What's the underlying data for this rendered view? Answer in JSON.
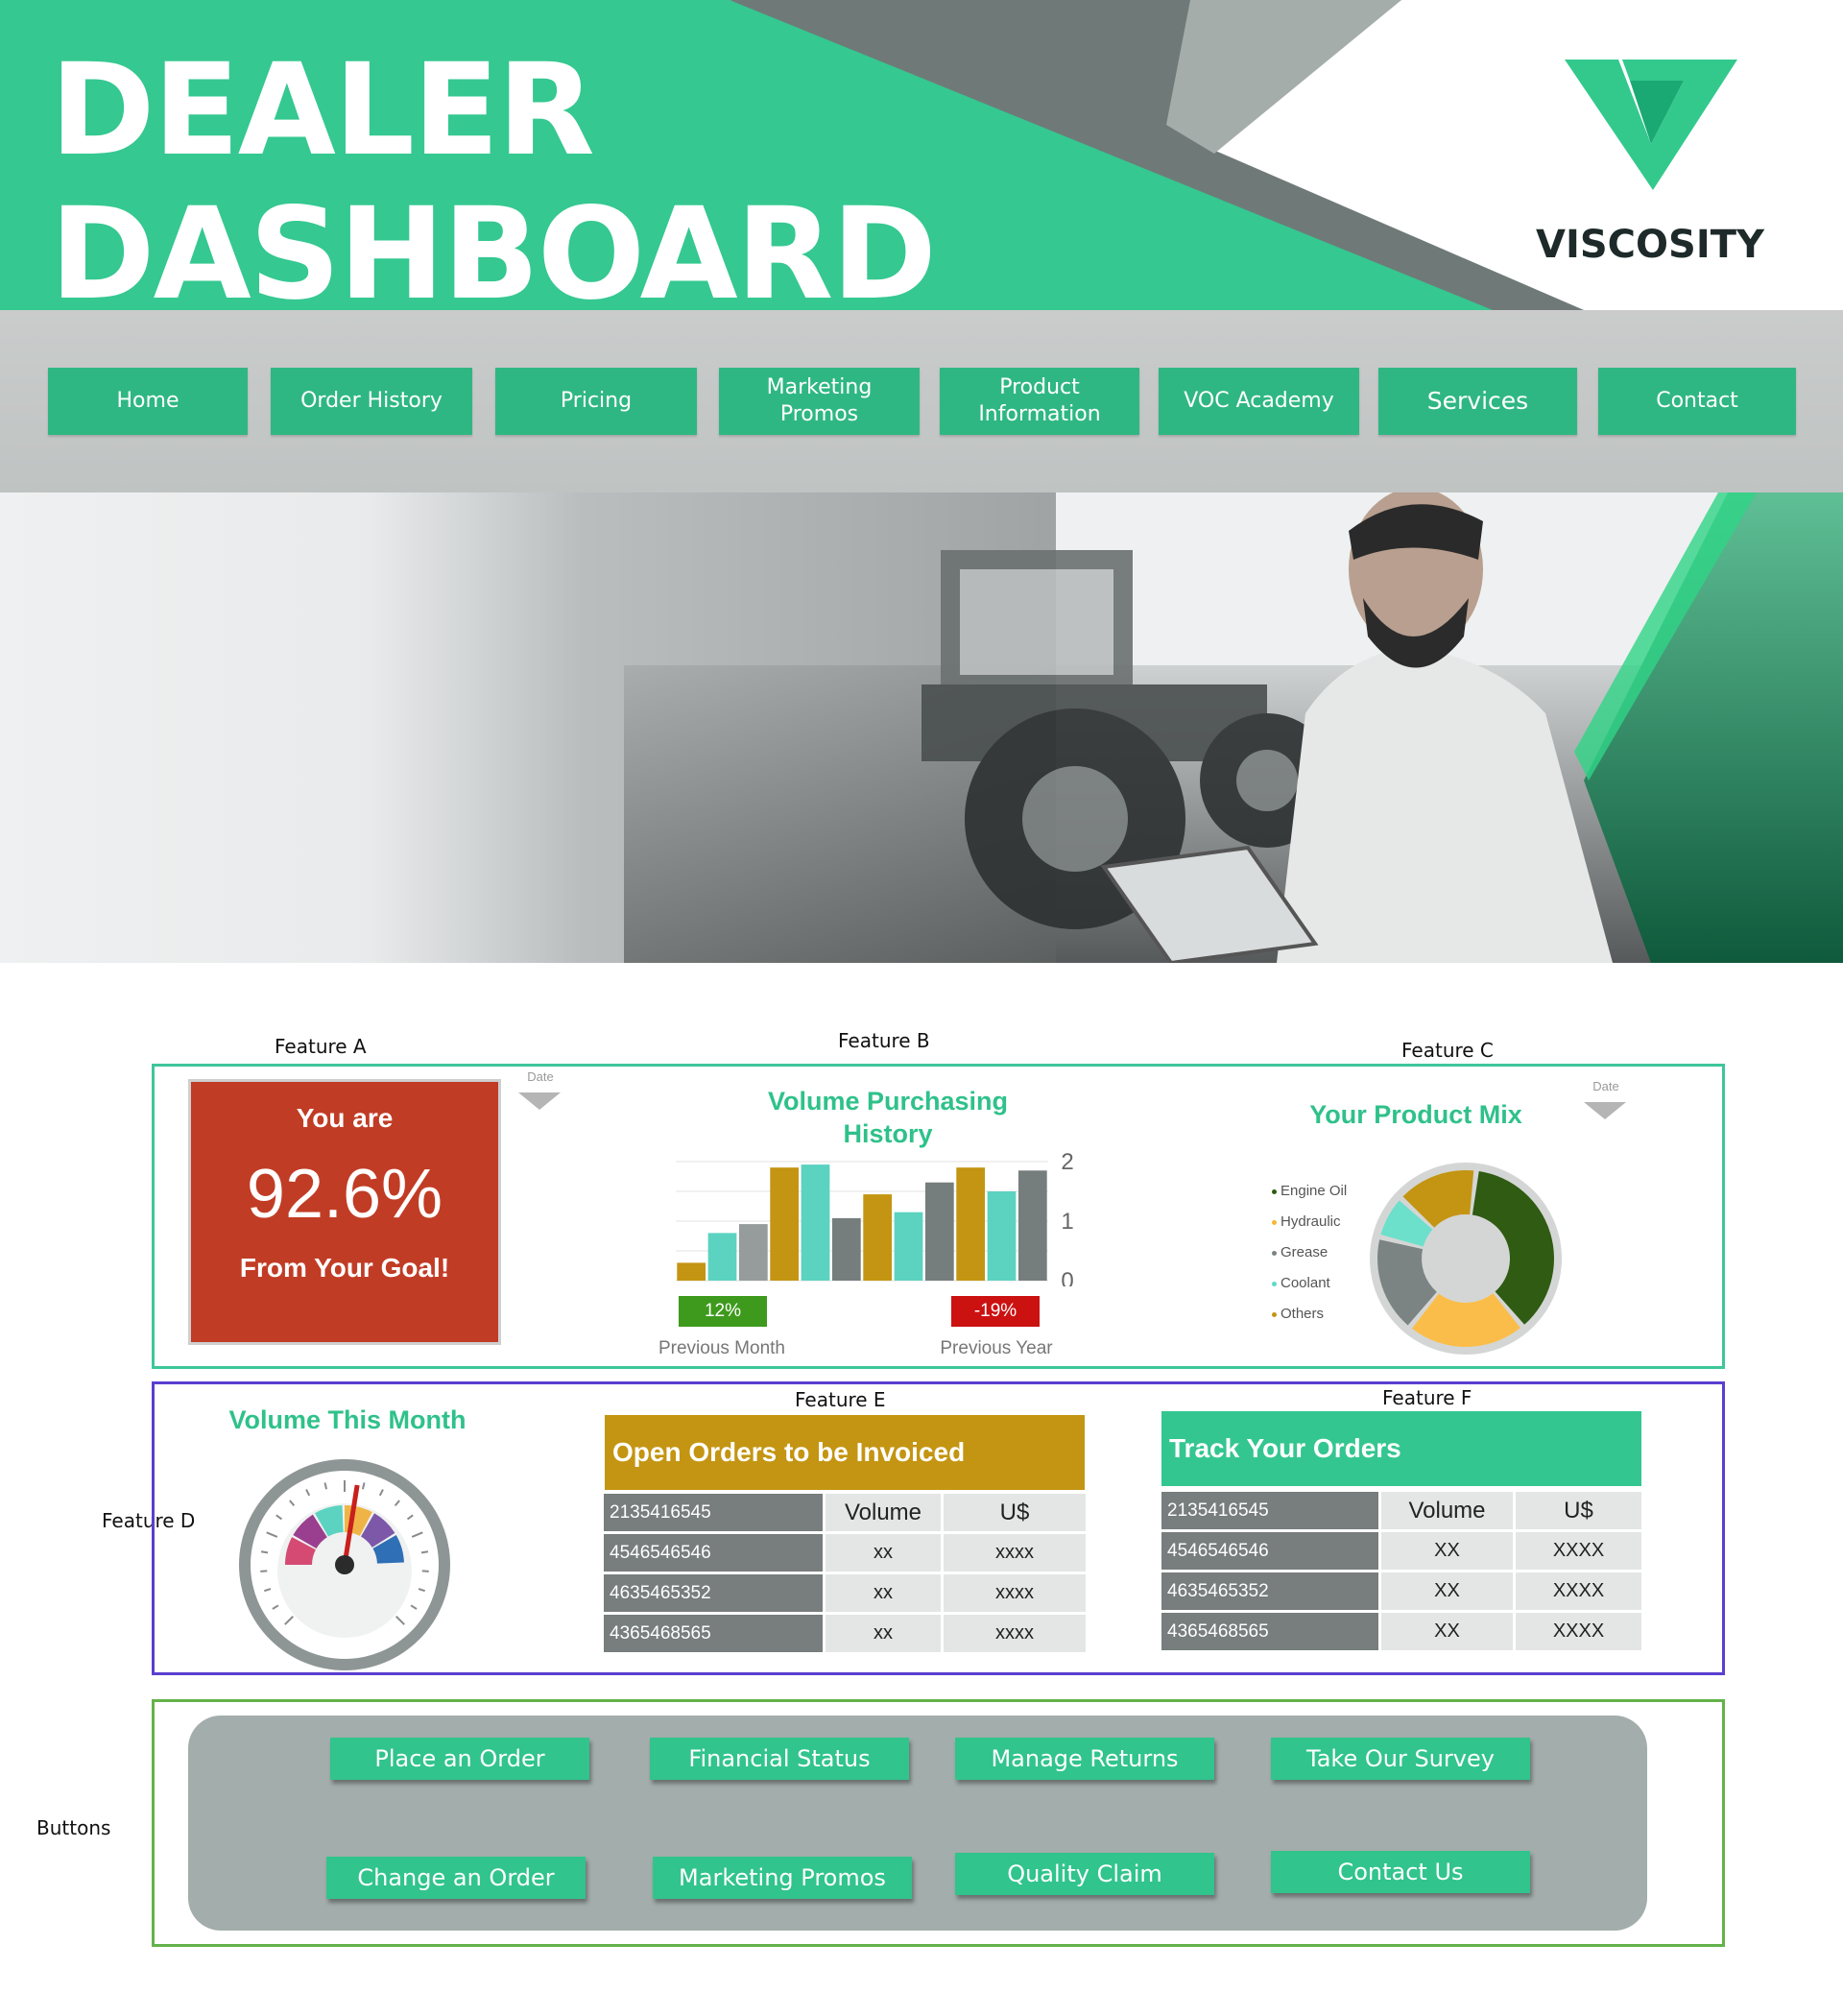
{
  "header": {
    "title_line1": "DEALER",
    "title_line2": "DASHBOARD",
    "logo_text": "VISCOSITY"
  },
  "nav": {
    "items": [
      {
        "label": "Home"
      },
      {
        "label": "Order History"
      },
      {
        "label": "Pricing"
      },
      {
        "label": "Marketing\nPromos"
      },
      {
        "label": "Product\nInformation"
      },
      {
        "label": "VOC Academy"
      },
      {
        "label": "Services"
      },
      {
        "label": "Contact"
      }
    ]
  },
  "features": {
    "a_label": "Feature A",
    "b_label": "Feature B",
    "c_label": "Feature C",
    "d_label": "Feature D",
    "e_label": "Feature E",
    "f_label": "Feature F",
    "buttons_label": "Buttons"
  },
  "feature_a": {
    "line1": "You are",
    "percent": "92.6%",
    "line2": "From Your Goal!",
    "date_label": "Date",
    "card_color": "#c13c25"
  },
  "feature_b": {
    "title_line1": "Volume Purchasing",
    "title_line2": "History",
    "previous_month_change": "12%",
    "previous_month_label": "Previous Month",
    "previous_year_change": "-19%",
    "previous_year_label": "Previous Year",
    "positive_color": "#3d9a1c",
    "negative_color": "#cc1111"
  },
  "feature_c": {
    "title": "Your Product Mix",
    "date_label": "Date"
  },
  "feature_d": {
    "title": "Volume This Month"
  },
  "feature_e": {
    "title": "Open Orders to be Invoiced",
    "header_color": "#c49512",
    "columns": [
      "2135416545",
      "Volume",
      "U$"
    ],
    "rows": [
      [
        "4546546546",
        "xx",
        "xxxx"
      ],
      [
        "4635465352",
        "xx",
        "xxxx"
      ],
      [
        "4365468565",
        "xx",
        "xxxx"
      ]
    ]
  },
  "feature_f": {
    "title": "Track Your Orders",
    "header_color": "#34c690",
    "columns": [
      "2135416545",
      "Volume",
      "U$"
    ],
    "rows": [
      [
        "4546546546",
        "XX",
        "XXXX"
      ],
      [
        "4635465352",
        "XX",
        "XXXX"
      ],
      [
        "4365468565",
        "XX",
        "XXXX"
      ]
    ]
  },
  "buttons": {
    "row1": [
      "Place an Order",
      "Financial Status",
      "Manage Returns",
      "Take Our Survey"
    ],
    "row2": [
      "Change an Order",
      "Marketing Promos",
      "Quality Claim",
      "Contact Us"
    ]
  },
  "chart_data": [
    {
      "type": "bar",
      "ylim": [
        0,
        2
      ],
      "yticks": [
        "2",
        "1",
        "0"
      ],
      "series_colors": [
        "#c49512",
        "#5bd3c0",
        "#959c9b",
        "#5bd3c0",
        "#5e6666"
      ],
      "values": [
        0.3,
        0.8,
        0.95,
        1.9,
        1.95,
        1.05,
        1.45,
        1.15,
        1.65,
        1.9,
        1.5,
        1.85
      ],
      "colors": [
        "#c49512",
        "#5bd3c0",
        "#959c9b",
        "#c49512",
        "#5bd3c0",
        "#767e7d",
        "#c49512",
        "#5bd3c0",
        "#767e7d",
        "#c49512",
        "#5bd3c0",
        "#767e7d"
      ]
    },
    {
      "type": "pie",
      "legend": [
        "Engine Oil",
        "Hydraulic",
        "Grease",
        "Coolant",
        "Others"
      ],
      "legend_colors": [
        "#2f5b12",
        "#f7b733",
        "#7b8483",
        "#5edcc8",
        "#c49512"
      ],
      "values": [
        37,
        22,
        18,
        8,
        15
      ],
      "slice_colors": [
        "#2f5b12",
        "#fbbd49",
        "#7b8483",
        "#6ce0cb",
        "#c49512"
      ]
    },
    {
      "type": "gauge",
      "value": 0.55
    }
  ]
}
